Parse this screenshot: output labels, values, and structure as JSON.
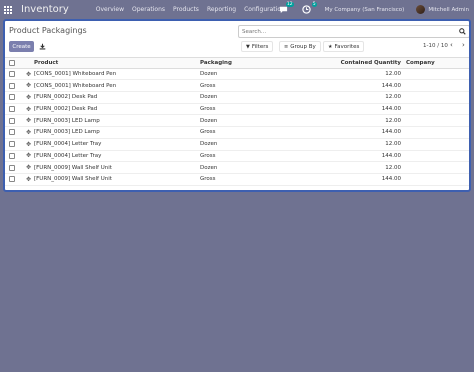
{
  "navbar": {
    "app_title": "Inventory",
    "menu": [
      "Overview",
      "Operations",
      "Products",
      "Reporting",
      "Configuration"
    ],
    "messages_count": "12",
    "activities_count": "5",
    "company": "My Company (San Francisco)",
    "user": "Mitchell Admin"
  },
  "control_panel": {
    "title": "Product Packagings",
    "search_placeholder": "Search...",
    "create_label": "Create",
    "filters_label": "Filters",
    "group_by_label": "Group By",
    "favorites_label": "Favorites",
    "pager": "1-10 / 10"
  },
  "table": {
    "headers": {
      "product": "Product",
      "packaging": "Packaging",
      "contained_quantity": "Contained Quantity",
      "company": "Company"
    },
    "rows": [
      {
        "product": "[CONS_0001] Whiteboard Pen",
        "packaging": "Dozen",
        "qty": "12.00",
        "company": ""
      },
      {
        "product": "[CONS_0001] Whiteboard Pen",
        "packaging": "Gross",
        "qty": "144.00",
        "company": ""
      },
      {
        "product": "[FURN_0002] Desk Pad",
        "packaging": "Dozen",
        "qty": "12.00",
        "company": ""
      },
      {
        "product": "[FURN_0002] Desk Pad",
        "packaging": "Gross",
        "qty": "144.00",
        "company": ""
      },
      {
        "product": "[FURN_0003] LED Lamp",
        "packaging": "Dozen",
        "qty": "12.00",
        "company": ""
      },
      {
        "product": "[FURN_0003] LED Lamp",
        "packaging": "Gross",
        "qty": "144.00",
        "company": ""
      },
      {
        "product": "[FURN_0004] Letter Tray",
        "packaging": "Dozen",
        "qty": "12.00",
        "company": ""
      },
      {
        "product": "[FURN_0004] Letter Tray",
        "packaging": "Gross",
        "qty": "144.00",
        "company": ""
      },
      {
        "product": "[FURN_0009] Wall Shelf Unit",
        "packaging": "Dozen",
        "qty": "12.00",
        "company": ""
      },
      {
        "product": "[FURN_0009] Wall Shelf Unit",
        "packaging": "Gross",
        "qty": "144.00",
        "company": ""
      }
    ]
  }
}
